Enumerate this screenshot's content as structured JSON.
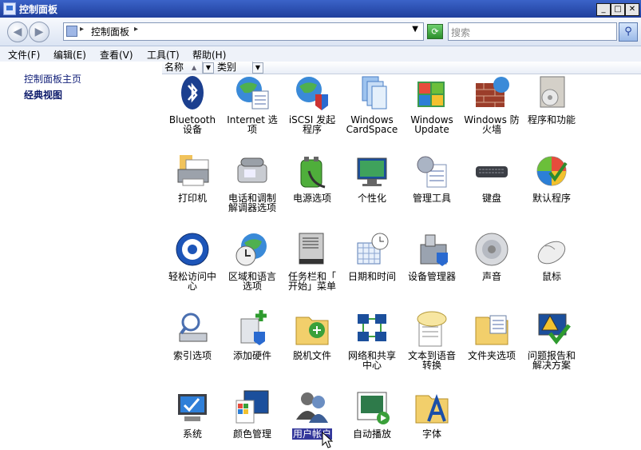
{
  "window": {
    "title": "控制面板"
  },
  "window_buttons": [
    "_",
    "□",
    "✕"
  ],
  "address": {
    "crumb": "控制面板",
    "search_placeholder": "搜索"
  },
  "menu": [
    "文件(F)",
    "编辑(E)",
    "查看(V)",
    "工具(T)",
    "帮助(H)"
  ],
  "columns": [
    "名称",
    "类别"
  ],
  "left_nav": [
    "控制面板主页",
    "经典视图"
  ],
  "items": [
    {
      "label": "Bluetooth\n设备",
      "icon": "bluetooth-icon"
    },
    {
      "label": "Internet 选\n项",
      "icon": "internet-options-icon"
    },
    {
      "label": "iSCSI 发起\n程序",
      "icon": "iscsi-icon"
    },
    {
      "label": "Windows\nCardSpace",
      "icon": "cardspace-icon"
    },
    {
      "label": "Windows\nUpdate",
      "icon": "windows-update-icon"
    },
    {
      "label": "Windows 防\n火墙",
      "icon": "firewall-icon"
    },
    {
      "label": "程序和功能",
      "icon": "programs-icon"
    },
    {
      "label": "打印机",
      "icon": "printer-icon"
    },
    {
      "label": "电话和调制\n解调器选项",
      "icon": "phone-modem-icon"
    },
    {
      "label": "电源选项",
      "icon": "power-icon"
    },
    {
      "label": "个性化",
      "icon": "personalize-icon"
    },
    {
      "label": "管理工具",
      "icon": "admin-tools-icon"
    },
    {
      "label": "键盘",
      "icon": "keyboard-icon"
    },
    {
      "label": "默认程序",
      "icon": "default-programs-icon"
    },
    {
      "label": "轻松访问中\n心",
      "icon": "ease-of-access-icon"
    },
    {
      "label": "区域和语言\n选项",
      "icon": "region-language-icon"
    },
    {
      "label": "任务栏和「\n开始」菜单",
      "icon": "taskbar-icon"
    },
    {
      "label": "日期和时间",
      "icon": "date-time-icon"
    },
    {
      "label": "设备管理器",
      "icon": "device-manager-icon"
    },
    {
      "label": "声音",
      "icon": "sound-icon"
    },
    {
      "label": "鼠标",
      "icon": "mouse-icon"
    },
    {
      "label": "索引选项",
      "icon": "index-icon"
    },
    {
      "label": "添加硬件",
      "icon": "add-hardware-icon"
    },
    {
      "label": "脱机文件",
      "icon": "offline-files-icon"
    },
    {
      "label": "网络和共享\n中心",
      "icon": "network-icon"
    },
    {
      "label": "文本到语音\n转换",
      "icon": "text-to-speech-icon"
    },
    {
      "label": "文件夹选项",
      "icon": "folder-options-icon"
    },
    {
      "label": "问题报告和\n解决方案",
      "icon": "problem-reports-icon"
    },
    {
      "label": "系统",
      "icon": "system-icon"
    },
    {
      "label": "颜色管理",
      "icon": "color-management-icon"
    },
    {
      "label": "用户帐户",
      "icon": "user-accounts-icon",
      "selected": true
    },
    {
      "label": "自动播放",
      "icon": "autoplay-icon"
    },
    {
      "label": "字体",
      "icon": "fonts-icon"
    }
  ]
}
